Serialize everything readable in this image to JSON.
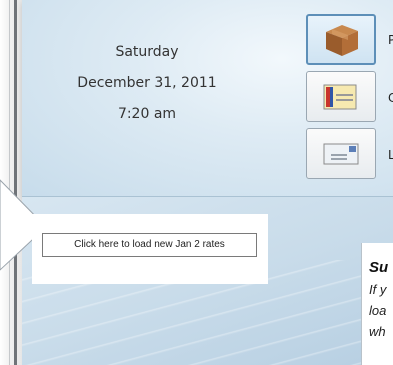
{
  "date": {
    "weekday": "Saturday",
    "full_date": "December 31, 2011",
    "time": "7:20 am"
  },
  "side_buttons": [
    {
      "label": "P",
      "icon": "package-icon"
    },
    {
      "label": "C",
      "icon": "card-icon"
    },
    {
      "label": "L",
      "icon": "letter-icon"
    }
  ],
  "rates_button": {
    "label": "Click here to load new Jan 2 rates"
  },
  "summary": {
    "title": "Su",
    "lines": [
      "If y",
      "loa",
      "wh"
    ]
  }
}
